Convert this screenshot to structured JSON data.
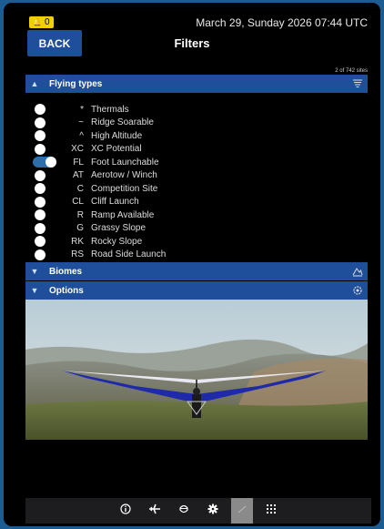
{
  "status": {
    "alert_count": "0",
    "datetime": "March 29, Sunday 2026 07:44 UTC"
  },
  "header": {
    "back_label": "BACK",
    "title": "Filters",
    "site_count": "2 of 742 sites"
  },
  "sections": {
    "flying_types": "Flying types",
    "biomes": "Biomes",
    "options": "Options"
  },
  "flying_types": [
    {
      "code": "*",
      "label": "Thermals",
      "enabled": false
    },
    {
      "code": "~",
      "label": "Ridge Soarable",
      "enabled": false
    },
    {
      "code": "^",
      "label": "High Altitude",
      "enabled": false
    },
    {
      "code": "XC",
      "label": "XC Potential",
      "enabled": false
    },
    {
      "code": "FL",
      "label": "Foot Launchable",
      "enabled": true
    },
    {
      "code": "AT",
      "label": "Aerotow / Winch",
      "enabled": false
    },
    {
      "code": "C",
      "label": "Competition Site",
      "enabled": false
    },
    {
      "code": "CL",
      "label": "Cliff Launch",
      "enabled": false
    },
    {
      "code": "R",
      "label": "Ramp Available",
      "enabled": false
    },
    {
      "code": "G",
      "label": "Grassy Slope",
      "enabled": false
    },
    {
      "code": "RK",
      "label": "Rocky Slope",
      "enabled": false
    },
    {
      "code": "RS",
      "label": "Road Side Launch",
      "enabled": false
    }
  ],
  "dock": [
    {
      "icon": "info-icon",
      "active": false
    },
    {
      "icon": "airplane-icon",
      "active": false
    },
    {
      "icon": "pilot-icon",
      "active": false
    },
    {
      "icon": "gear-icon",
      "active": false
    },
    {
      "icon": "glider-icon",
      "active": true
    },
    {
      "icon": "grid-icon",
      "active": false
    }
  ],
  "colors": {
    "section_bar": "#1f4f9a",
    "badge": "#f2cf00",
    "toggle_on": "#2f6ea8",
    "background": "#000000",
    "border": "#1b5c93"
  }
}
